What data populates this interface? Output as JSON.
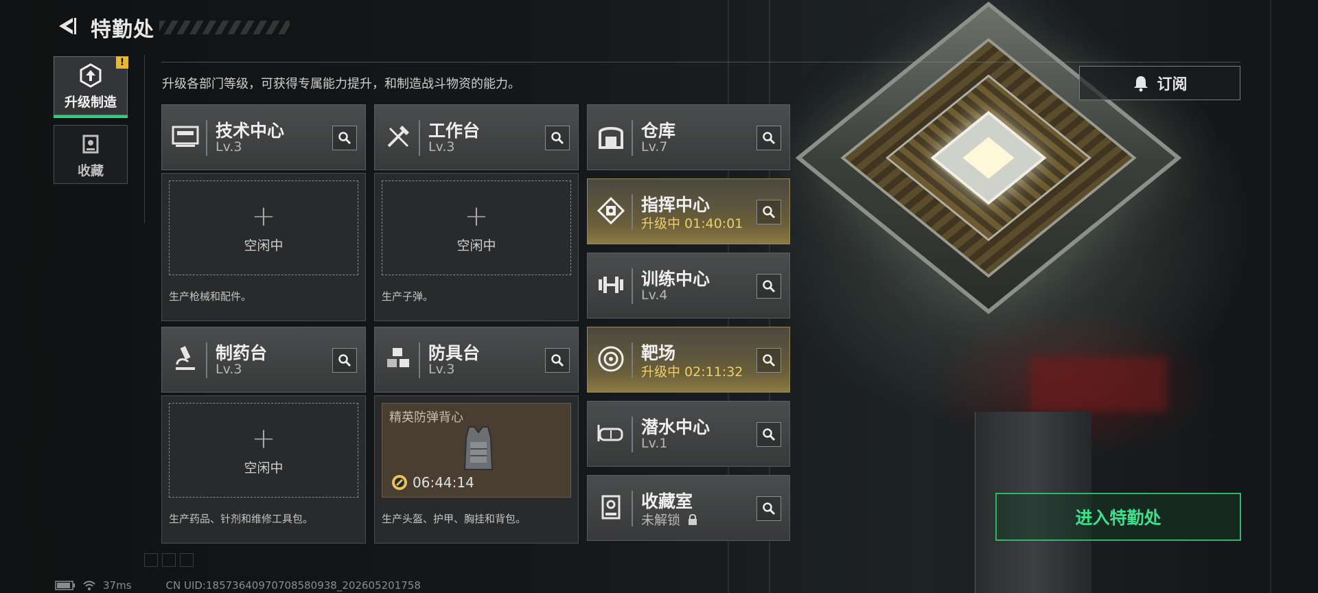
{
  "header": {
    "title": "特勤处"
  },
  "sidebar": {
    "items": [
      {
        "label": "升级制造",
        "active": true,
        "alert": "!"
      },
      {
        "label": "收藏",
        "active": false
      }
    ]
  },
  "description": "升级各部门等级，可获得专属能力提升，和制造战斗物资的能力。",
  "subscribe": {
    "label": "订阅",
    "icon": "bell-icon"
  },
  "departments": {
    "tech": {
      "name": "技术中心",
      "level": "Lv.3",
      "icon": "tech-center-icon"
    },
    "workbench": {
      "name": "工作台",
      "level": "Lv.3",
      "icon": "tools-icon"
    },
    "pharmacy": {
      "name": "制药台",
      "level": "Lv.3",
      "icon": "microscope-icon"
    },
    "armory": {
      "name": "防具台",
      "level": "Lv.3",
      "icon": "armor-blocks-icon"
    },
    "warehouse": {
      "name": "仓库",
      "level": "Lv.7",
      "icon": "warehouse-icon"
    },
    "command": {
      "name": "指挥中心",
      "level": "升级中 01:40:01",
      "upgrading": true,
      "icon": "command-chip-icon"
    },
    "training": {
      "name": "训练中心",
      "level": "Lv.4",
      "icon": "dumbbell-icon"
    },
    "range": {
      "name": "靶场",
      "level": "升级中 02:11:32",
      "upgrading": true,
      "icon": "target-icon"
    },
    "diving": {
      "name": "潜水中心",
      "level": "Lv.1",
      "icon": "diving-mask-icon"
    },
    "collection_room": {
      "name": "收藏室",
      "level": "未解锁",
      "locked": true,
      "icon": "collection-room-icon"
    }
  },
  "production": {
    "tech": {
      "slot_status": "空闲中",
      "description": "生产枪械和配件。"
    },
    "workbench": {
      "slot_status": "空闲中",
      "description": "生产子弹。"
    },
    "pharmacy": {
      "slot_status": "空闲中",
      "description": "生产药品、针剂和维修工具包。"
    },
    "armory": {
      "item_name": "精英防弹背心",
      "timer": "06:44:14",
      "description": "生产头盔、护甲、胸挂和背包。"
    }
  },
  "enter_button": {
    "label": "进入特勤处"
  },
  "status_bar": {
    "ping": "37ms",
    "uid": "CN UID:18573640970708580938_202605201758"
  },
  "colors": {
    "accent_green": "#2fd17c",
    "upgrade_gold": "#f0cf6a",
    "alert_yellow": "#e8b930"
  }
}
